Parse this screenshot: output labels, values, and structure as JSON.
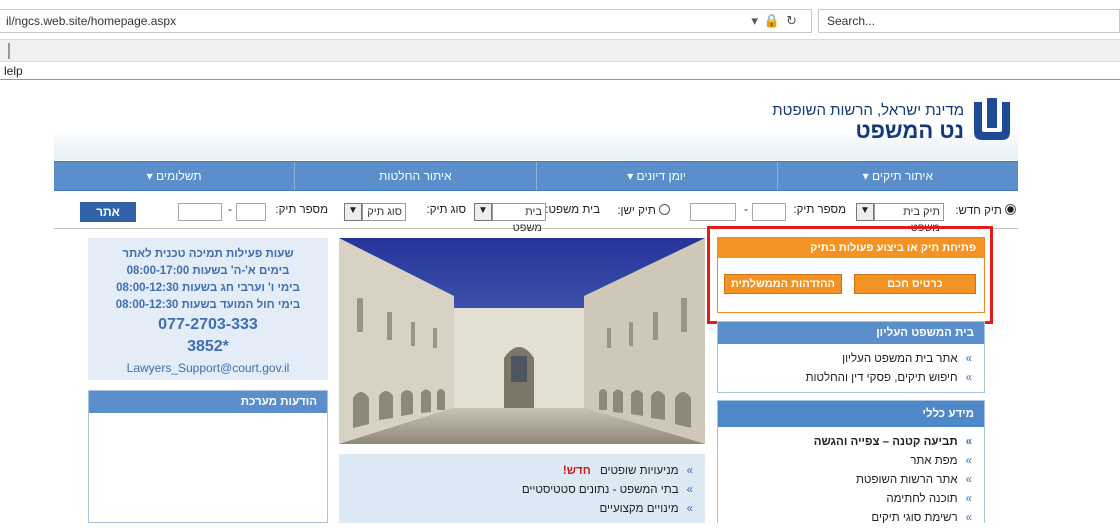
{
  "browser": {
    "address": "il/ngcs.web.site/homepage.aspx",
    "search_placeholder": "Search...",
    "menu_help": "lelp"
  },
  "header": {
    "org_line": "מדינת ישראל, הרשות השופטת",
    "site_name": "נט המשפט"
  },
  "nav": {
    "items": [
      {
        "label": "איתור תיקים ▾"
      },
      {
        "label": "יומן דיונים ▾"
      },
      {
        "label": "איתור החלטות"
      },
      {
        "label": "תשלומים ▾"
      }
    ]
  },
  "case_search": {
    "new_case_label": "תיק חדש:",
    "case_type_select": "תיק בית משפט",
    "case_number_label": "מספר תיק:",
    "old_case_label": "תיק ישן:",
    "court_label": "בית משפט:",
    "court_select": "בית משפט",
    "type_label": "סוג תיק:",
    "type_select": "סוג תיק",
    "case_number_label_2": "מספר תיק:",
    "dash": "-",
    "go_button": "אתר"
  },
  "actions": {
    "title": "פתיחת תיק או ביצוע פעולות בתיק",
    "smart_card": "כרטיס חכם",
    "gov_id": "ההזדהות הממשלתית"
  },
  "supreme_court": {
    "title": "בית המשפט העליון",
    "links": [
      "אתר בית המשפט העליון",
      "חיפוש תיקים, פסקי דין והחלטות"
    ]
  },
  "general_info": {
    "title": "מידע כללי",
    "links": [
      {
        "text": "תביעה קטנה – צפייה והגשה",
        "bold": true
      },
      {
        "text": "מפת אתר"
      },
      {
        "text": "אתר הרשות השופטת"
      },
      {
        "text": "תוכנה לחתימה"
      },
      {
        "text": "רשימת סוגי תיקים"
      }
    ]
  },
  "middle_links": [
    {
      "text": "מניעויות שופטים",
      "badge": "חדש!"
    },
    {
      "text": "בתי המשפט - נתונים סטטיסטיים"
    },
    {
      "text": "מינויים מקצועיים"
    }
  ],
  "support": {
    "line1": "שעות פעילות תמיכה טכנית לאתר",
    "line2": "בימים א'-ה' בשעות 08:00-17:00",
    "line3": "בימי ו' וערבי חג בשעות 08:00-12:30",
    "line4": "בימי חול המועד בשעות 08:00-12:30",
    "phone": "077-2703-333",
    "short_phone": "*3852",
    "email": "Lawyers_Support@court.gov.il"
  },
  "system_messages": {
    "title": "הודעות מערכת"
  },
  "colors": {
    "nav_blue": "#5a8fcb",
    "orange": "#f39323",
    "highlight_red": "#e21b1b"
  }
}
